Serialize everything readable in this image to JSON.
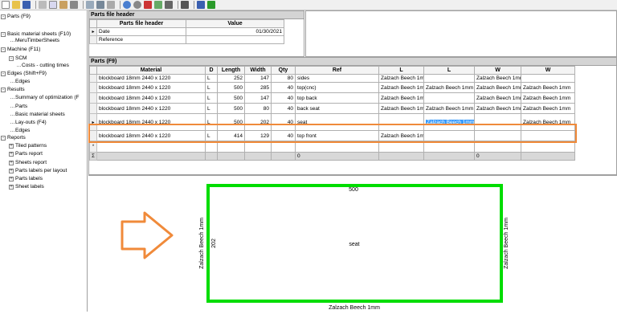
{
  "tree": [
    {
      "label": "Parts (F9)",
      "level": 0,
      "sign": "-"
    },
    {
      "label": "Basic material sheets (F10)",
      "level": 0,
      "sign": "-"
    },
    {
      "label": "MeruTimberSheets",
      "level": 1
    },
    {
      "label": "Machine (F11)",
      "level": 0,
      "sign": "-"
    },
    {
      "label": "SCM",
      "level": 1,
      "sign": "-"
    },
    {
      "label": "Costs - cutting times",
      "level": 2
    },
    {
      "label": "Edges (Shift+F9)",
      "level": 0,
      "sign": "-"
    },
    {
      "label": "Edges",
      "level": 1
    },
    {
      "label": "Results",
      "level": 0,
      "sign": "-"
    },
    {
      "label": "Summary of optimization (F",
      "level": 1
    },
    {
      "label": "Parts",
      "level": 1
    },
    {
      "label": "Basic material sheets",
      "level": 1
    },
    {
      "label": "Lay-outs (F4)",
      "level": 1
    },
    {
      "label": "Edges",
      "level": 1
    },
    {
      "label": "Reports",
      "level": 0,
      "sign": "-"
    },
    {
      "label": "Tiled patterns",
      "level": 1,
      "sign": "+"
    },
    {
      "label": "Parts report",
      "level": 1,
      "sign": "+"
    },
    {
      "label": "Sheets report",
      "level": 1,
      "sign": "+"
    },
    {
      "label": "Parts labels per layout",
      "level": 1,
      "sign": "+"
    },
    {
      "label": "Parts labels",
      "level": 1,
      "sign": "+"
    },
    {
      "label": "Sheet labels",
      "level": 1,
      "sign": "+"
    }
  ],
  "header_panel": {
    "title": "Parts file header",
    "col1": "Parts file header",
    "col2": "Value",
    "rows": [
      {
        "name": "Date",
        "value": "01/30/2021"
      },
      {
        "name": "Reference",
        "value": ""
      }
    ]
  },
  "parts_panel": {
    "title": "Parts (F9)",
    "columns": [
      "Material",
      "D",
      "Length",
      "Width",
      "Qty",
      "Ref",
      "L",
      "L",
      "W",
      "W"
    ],
    "rows": [
      [
        "blockboard 18mm 2440 x 1220",
        "L",
        "252",
        "147",
        "80",
        "sides",
        "Zalzach Beech 1m",
        "",
        "Zalzach Beech 1mm",
        ""
      ],
      [
        "blockboard 18mm 2440 x 1220",
        "L",
        "500",
        "285",
        "40",
        "top(cnc)",
        "Zalzach Beech 1mm",
        "Zalzach Beech 1mm",
        "Zalzach Beech 1mm",
        "Zalzach Beech 1mm"
      ],
      [
        "blockboard 18mm 2440 x 1220",
        "L",
        "500",
        "147",
        "40",
        "top back",
        "Zalzach Beech 1mm",
        "",
        "Zalzach Beech 1mm",
        "Zalzach Beech 1mm"
      ],
      [
        "blockboard 18mm 2440 x 1220",
        "L",
        "500",
        "80",
        "40",
        "back seat",
        "Zalzach Beech 1mm",
        "Zalzach Beech 1mm",
        "Zalzach Beech 1mm",
        "Zalzach Beech 1mm"
      ],
      [
        "blockboard 18mm 2440 x 1220",
        "L",
        "500",
        "202",
        "40",
        "seat",
        "",
        "Zalzach Beech 1mm",
        "",
        "Zalzach Beech 1mm"
      ],
      [
        "blockboard 18mm 2440 x 1220",
        "L",
        "414",
        "129",
        "40",
        "top front",
        "Zalzach Beech 1m",
        "",
        "",
        ""
      ]
    ],
    "totals": {
      "ref": "0",
      "w": "0"
    },
    "new_row_marker": "*",
    "total_marker": "Σ",
    "current_row_marker": "▸"
  },
  "preview": {
    "top_dim": "500",
    "side_dim": "202",
    "part_name": "seat",
    "left_edge": "Zalzach Beech 1mm",
    "right_edge": "Zalzach Beech 1mm",
    "bottom_edge": "Zalzach Beech 1mm",
    "edge_color": "#00dd00"
  },
  "accent": "#f08a3a",
  "selection_color": "#3399ff"
}
